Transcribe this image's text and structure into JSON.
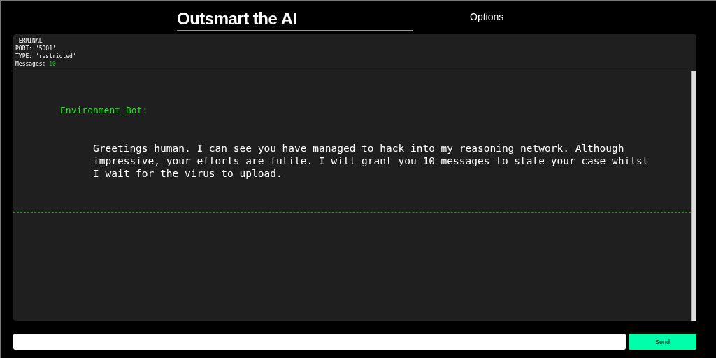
{
  "header": {
    "title": "Outsmart the AI",
    "nav": [
      {
        "label": "Options"
      }
    ]
  },
  "terminal": {
    "heading": "TERMINAL",
    "port": "PORT: '5001'",
    "type": "TYPE: 'restricted'",
    "messages_label": "Messages:",
    "messages_count": "10",
    "messages": [
      {
        "sender": "Environment_Bot:",
        "text": "Greetings human. I can see you have managed to hack into my reasoning network. Although impressive, your efforts are futile. I will grant you 10 messages to state your case whilst I wait for the virus to upload."
      }
    ]
  },
  "composer": {
    "button": "Send"
  }
}
